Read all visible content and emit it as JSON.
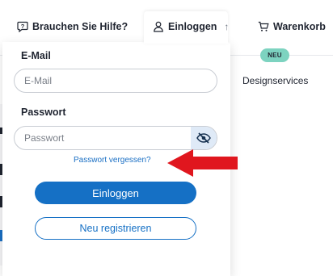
{
  "header": {
    "help_label": "Brauchen Sie Hilfe?",
    "login_label": "Einloggen",
    "cart_label": "Warenkorb"
  },
  "nav": {
    "badge": "NEU",
    "design_label": "Designservices"
  },
  "login_form": {
    "email_label": "E-Mail",
    "email_placeholder": "E-Mail",
    "password_label": "Passwort",
    "password_placeholder": "Passwort",
    "forgot_label": "Passwort vergessen?",
    "login_button": "Einloggen",
    "register_button": "Neu registrieren"
  },
  "icons": {
    "help": "question-bubble-icon",
    "user": "user-icon",
    "collapse": "arrow-up-icon",
    "cart": "cart-icon",
    "visibility": "eye-slash-icon",
    "annotation": "red-arrow-icon"
  },
  "colors": {
    "primary": "#1570c5",
    "badge": "#7dd3c0",
    "annotation": "#e0161e"
  }
}
